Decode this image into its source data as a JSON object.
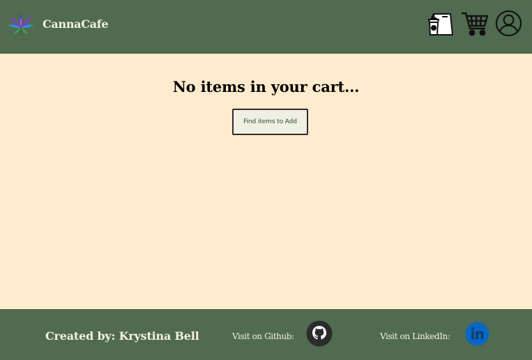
{
  "header": {
    "brand": "CannaCafe",
    "icons": [
      "cannabis-leaf-logo",
      "coffee-bag-icon",
      "shopping-cart-icon",
      "account-icon"
    ]
  },
  "main": {
    "empty_message": "No items in your cart...",
    "find_button_label": "Find items to Add"
  },
  "footer": {
    "credit": "Created by: Krystina Bell",
    "github_label": "Visit on Github:",
    "linkedin_label": "Visit on LinkedIn:"
  },
  "colors": {
    "header_bg": "#506b50",
    "page_bg": "#ffebcd",
    "header_text": "#f3f1e6",
    "linkedin_blue": "#0a66c2",
    "github_dark": "#2b2b2b"
  }
}
